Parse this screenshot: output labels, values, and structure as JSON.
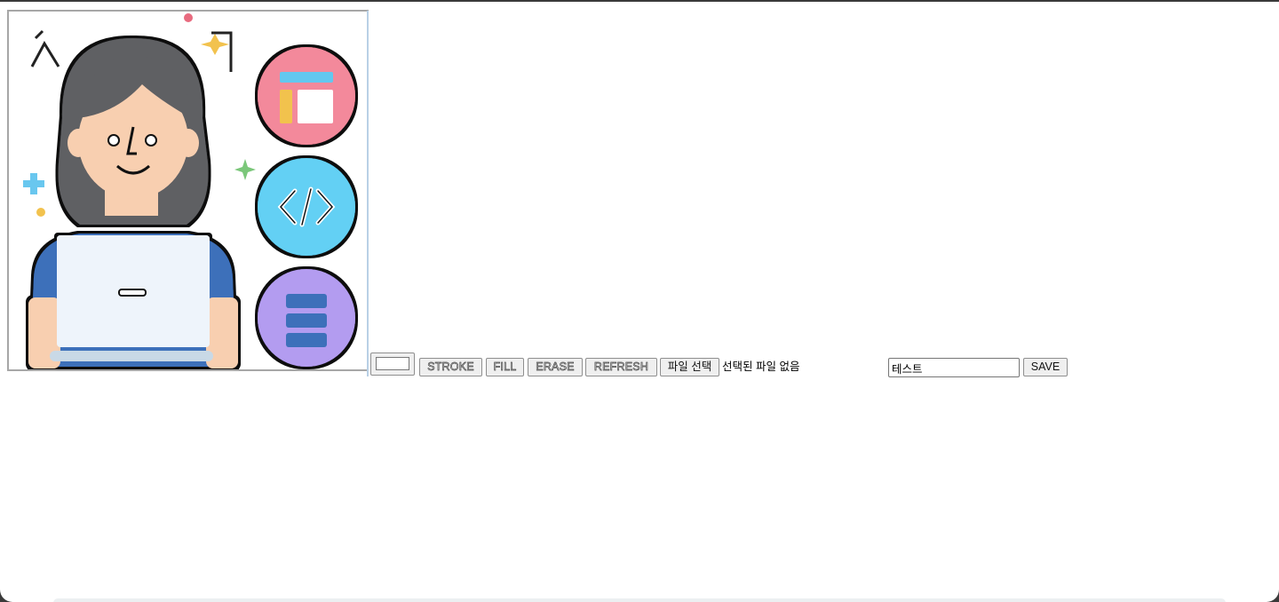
{
  "canvas": {
    "artwork_icons": [
      "woman-with-laptop-illustration",
      "layout-icon",
      "code-icon",
      "database-icon"
    ]
  },
  "toolbar": {
    "color_value": "#ffffff",
    "buttons": {
      "stroke": "STROKE",
      "fill": "FILL",
      "erase": "ERASE",
      "refresh": "REFRESH"
    },
    "file_button": "파일 선택",
    "file_status": "선택된 파일 없음",
    "text_value": "테스트",
    "save": "SAVE"
  }
}
